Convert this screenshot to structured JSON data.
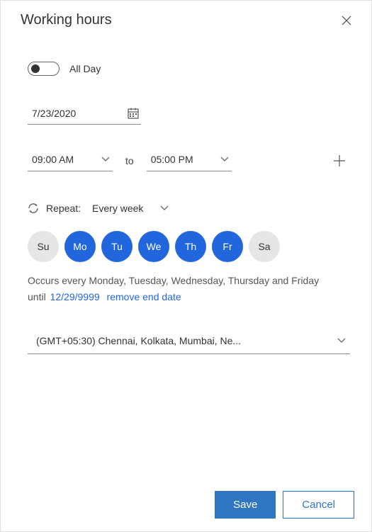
{
  "header": {
    "title": "Working hours"
  },
  "allDay": {
    "label": "All Day"
  },
  "date": {
    "value": "7/23/2020"
  },
  "time": {
    "start": "09:00 AM",
    "end": "05:00 PM",
    "to_label": "to"
  },
  "repeat": {
    "label": "Repeat:",
    "value": "Every week"
  },
  "days": {
    "su": "Su",
    "mo": "Mo",
    "tu": "Tu",
    "we": "We",
    "th": "Th",
    "fr": "Fr",
    "sa": "Sa"
  },
  "occurs": {
    "text": "Occurs every Monday, Tuesday, Wednesday, Thursday and Friday",
    "until_label": "until",
    "until_date": "12/29/9999",
    "remove": "remove end date"
  },
  "timezone": {
    "value": "(GMT+05:30) Chennai, Kolkata, Mumbai, Ne..."
  },
  "footer": {
    "save": "Save",
    "cancel": "Cancel"
  }
}
